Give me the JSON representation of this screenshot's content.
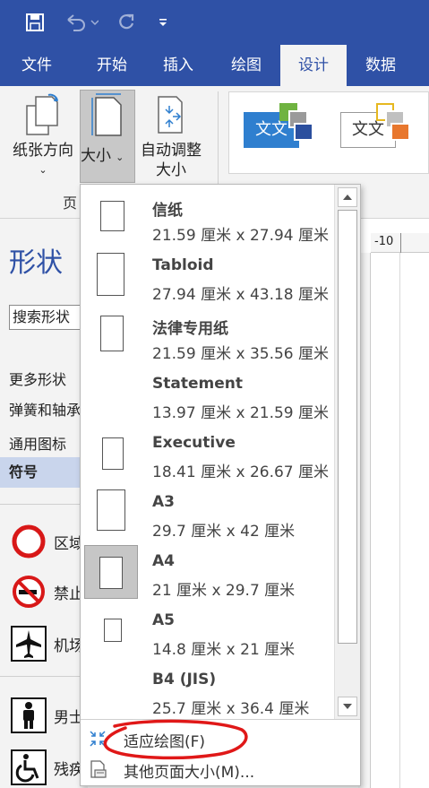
{
  "quick_access": {
    "save_icon": "save-icon",
    "undo_icon": "undo-icon",
    "redo_icon": "redo-icon",
    "customize_icon": "customize-qat-icon"
  },
  "tabs": [
    {
      "label": "文件",
      "active": false
    },
    {
      "label": "开始",
      "active": false
    },
    {
      "label": "插入",
      "active": false
    },
    {
      "label": "绘图",
      "active": false
    },
    {
      "label": "设计",
      "active": true
    },
    {
      "label": "数据",
      "active": false
    }
  ],
  "ribbon": {
    "orientation_label": "纸张方向",
    "size_label": "大小",
    "autofit_label_1": "自动调整",
    "autofit_label_2": "大小",
    "group_label": "页",
    "theme_1_text": "文文",
    "theme_2_text": "文文"
  },
  "pane": {
    "title": "形状",
    "search_placeholder": "搜索形状",
    "items": [
      "更多形状",
      "弹簧和轴承",
      "通用图标",
      "符号"
    ],
    "selected_item": "符号",
    "shapes": [
      {
        "label": "区域",
        "icon": "no-entry-circle-icon"
      },
      {
        "label": "禁止吸烟",
        "icon": "no-smoking-icon"
      },
      {
        "label": "机场",
        "icon": "airplane-icon"
      },
      {
        "label": "男士",
        "icon": "man-icon"
      },
      {
        "label": "残疾人",
        "icon": "wheelchair-icon"
      }
    ]
  },
  "ruler": {
    "tick_label": "-10"
  },
  "dropdown": {
    "sizes": [
      {
        "name": "信纸",
        "dims": "21.59 厘米 x 27.94 厘米"
      },
      {
        "name": "Tabloid",
        "dims": "27.94 厘米 x 43.18 厘米"
      },
      {
        "name": "法律专用纸",
        "dims": "21.59 厘米 x 35.56 厘米"
      },
      {
        "name": "Statement",
        "dims": "13.97 厘米 x 21.59 厘米"
      },
      {
        "name": "Executive",
        "dims": "18.41 厘米 x 26.67 厘米"
      },
      {
        "name": "A3",
        "dims": "29.7 厘米 x 42 厘米"
      },
      {
        "name": "A4",
        "dims": "21 厘米 x 29.7 厘米"
      },
      {
        "name": "A5",
        "dims": "14.8 厘米 x 21 厘米"
      },
      {
        "name": "B4 (JIS)",
        "dims": "25.7 厘米 x 36.4 厘米"
      }
    ],
    "selected": "A4",
    "fit_to_drawing": "适应绘图(F)",
    "more_sizes": "其他页面大小(M)..."
  },
  "colors": {
    "accent": "#2f51a6",
    "ribbon_bg": "#f3f3f3",
    "annotation": "#e01818"
  }
}
